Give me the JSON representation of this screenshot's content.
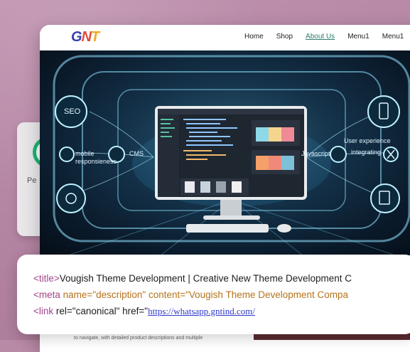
{
  "back_card": {
    "label": "Pe"
  },
  "nav": {
    "items": [
      {
        "label": "Home"
      },
      {
        "label": "Shop"
      },
      {
        "label": "About Us"
      },
      {
        "label": "Menu1"
      },
      {
        "label": "Menu1"
      }
    ]
  },
  "hero": {
    "labels": {
      "seo": "SEO",
      "mobile": "mobile\nresponsieness",
      "cms": "CMS",
      "javascript": "Javascript",
      "user_experience": "User experience",
      "integrating": "integrating"
    }
  },
  "code": {
    "line1": {
      "tag": "<title>",
      "text": "Vougish Theme Development | Creative New Theme Development C"
    },
    "line2": {
      "tag": "<meta",
      "attr1": " name=",
      "val1": "\"description\"",
      "attr2": " content=",
      "val2": "\"Vougish Theme Development Compa"
    },
    "line3": {
      "tag": "<link",
      "text": " rel=\"canonical\" href=\"",
      "url": "https://whatsapp.gntind.com/"
    }
  },
  "under_text": "to navigate, with detailed product descriptions and multiple"
}
